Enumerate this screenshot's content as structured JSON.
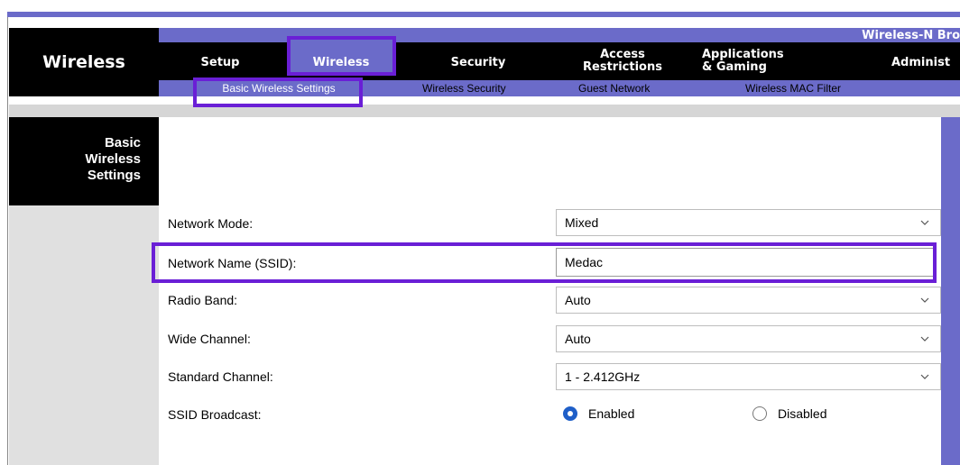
{
  "header": {
    "section_title": "Wireless",
    "product_name": "Wireless-N Bro"
  },
  "main_nav": {
    "setup": "Setup",
    "wireless": "Wireless",
    "security": "Security",
    "access_line1": "Access",
    "access_line2": "Restrictions",
    "apps_line1": "Applications",
    "apps_line2": "& Gaming",
    "administration": "Administ"
  },
  "sub_nav": {
    "basic": "Basic Wireless Settings",
    "security": "Wireless Security",
    "guest": "Guest Network",
    "mac": "Wireless MAC Filter"
  },
  "side": {
    "title_line1": "Basic",
    "title_line2": "Wireless",
    "title_line3": "Settings"
  },
  "form": {
    "network_mode": {
      "label": "Network Mode:",
      "value": "Mixed"
    },
    "ssid": {
      "label": "Network Name (SSID):",
      "value": "Medac"
    },
    "radio_band": {
      "label": "Radio Band:",
      "value": "Auto"
    },
    "wide_channel": {
      "label": "Wide Channel:",
      "value": "Auto"
    },
    "standard_channel": {
      "label": "Standard Channel:",
      "value": "1 - 2.412GHz"
    },
    "ssid_broadcast": {
      "label": "SSID Broadcast:",
      "enabled_label": "Enabled",
      "disabled_label": "Disabled",
      "selected": "Enabled"
    }
  },
  "colors": {
    "nav_purple": "#6b6bc9",
    "highlight": "#6a1fd6",
    "radio_selected": "#1f5fc8"
  }
}
